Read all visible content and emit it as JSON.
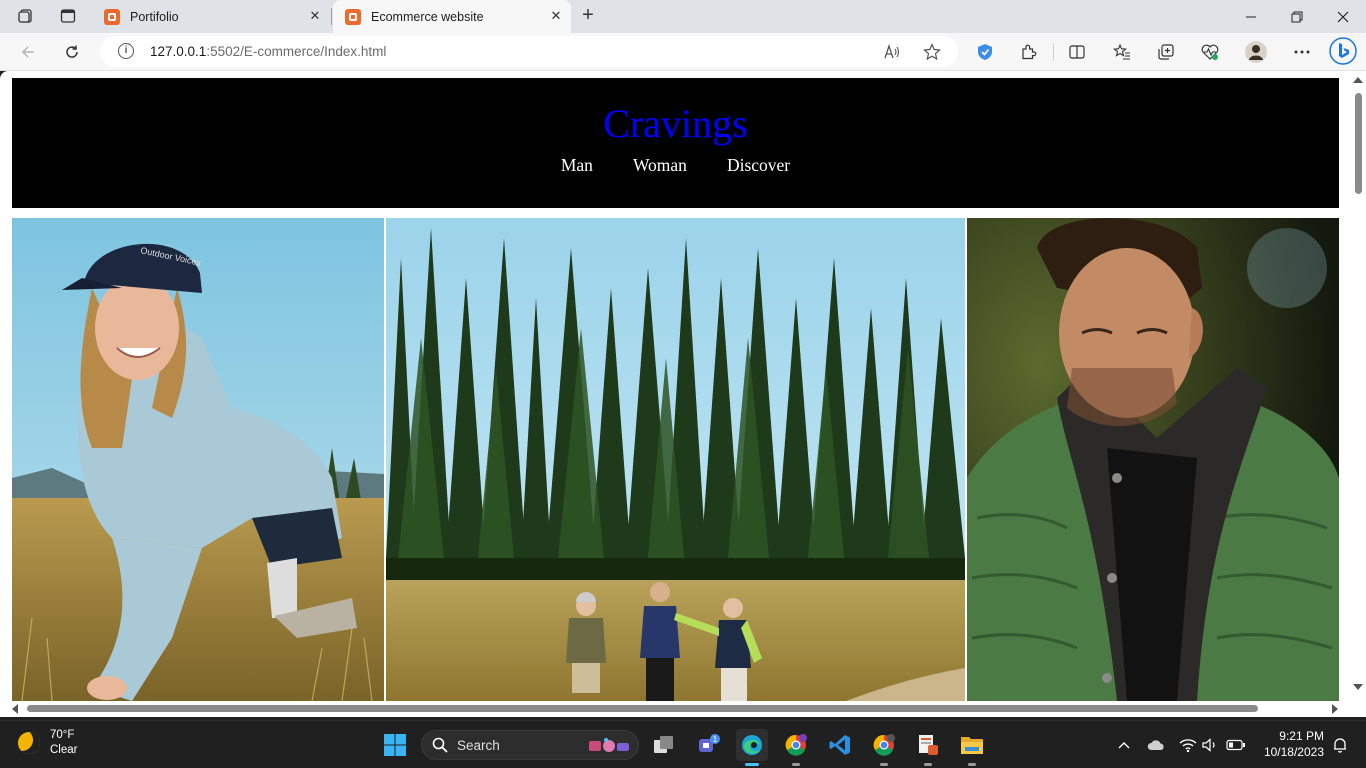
{
  "browser": {
    "tabs": [
      {
        "title": "Portifolio"
      },
      {
        "title": "Ecommerce website"
      }
    ],
    "url_host": "127.0.0.1",
    "url_port": ":5502",
    "url_path": "/E-commerce/Index.html"
  },
  "site": {
    "brand": "Cravings",
    "brand_color": "#0000ff",
    "nav": [
      "Man",
      "Woman",
      "Discover"
    ],
    "hero_images": [
      "woman-hiker-photo",
      "hikers-in-meadow-photo",
      "man-in-green-jacket-photo"
    ]
  },
  "taskbar": {
    "weather_temp": "70°F",
    "weather_desc": "Clear",
    "search_placeholder": "Search",
    "teams_badge": "1",
    "time": "9:21 PM",
    "date": "10/18/2023"
  }
}
